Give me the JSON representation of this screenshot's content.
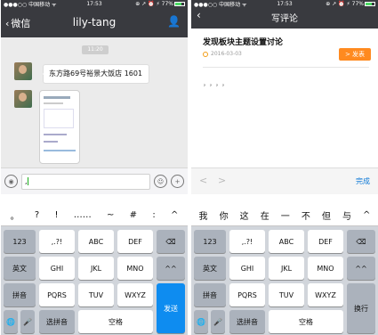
{
  "left": {
    "status": {
      "carrier": "●●●○○ 中国移动 ᯤ",
      "time": "17:53",
      "right": "⊕ ↗ ⏰ ⚡ 77%"
    },
    "nav": {
      "back": "微信",
      "title": "lily-tang",
      "right_icon": "person-icon"
    },
    "chat": {
      "timestamp": "11:20",
      "text_message": "东方路69号裕景大饭店 1601",
      "image_message": {
        "title": "iOS"
      }
    },
    "input": {
      "value": ","
    },
    "candidates": [
      "。",
      "?",
      "!",
      "……",
      "~",
      "#",
      ":",
      "^"
    ],
    "keyboard": {
      "row1": [
        "123",
        ",.?!",
        "ABC",
        "DEF",
        "⌫"
      ],
      "row2": [
        "英文",
        "GHI",
        "JKL",
        "MNO",
        "^^"
      ],
      "row3": [
        "拼音",
        "PQRS",
        "TUV",
        "WXYZ"
      ],
      "row4": [
        "🌐",
        "🎤",
        "选拼音",
        "空格"
      ],
      "send": "发送"
    }
  },
  "right": {
    "status": {
      "carrier": "●●●○○ 中国移动 ᯤ",
      "time": "17:53",
      "right": "⊕ ↗ ⏰ ⚡ 77%"
    },
    "nav": {
      "back": "‹",
      "title": "写评论"
    },
    "article": {
      "title": "发现板块主题设置讨论",
      "date": "2016-03-03",
      "publish": "> 发表"
    },
    "editor_text": "，，，，",
    "toolbar": {
      "prev": "<",
      "next": ">",
      "done": "完成"
    },
    "candidates": [
      "我",
      "你",
      "这",
      "在",
      "一",
      "不",
      "但",
      "与",
      "^"
    ],
    "keyboard": {
      "row1": [
        "123",
        ",.?!",
        "ABC",
        "DEF",
        "⌫"
      ],
      "row2": [
        "英文",
        "GHI",
        "JKL",
        "MNO",
        "^^"
      ],
      "row3": [
        "拼音",
        "PQRS",
        "TUV",
        "WXYZ"
      ],
      "row4": [
        "🌐",
        "🎤",
        "选拼音",
        "空格"
      ],
      "newline": "换行"
    }
  }
}
